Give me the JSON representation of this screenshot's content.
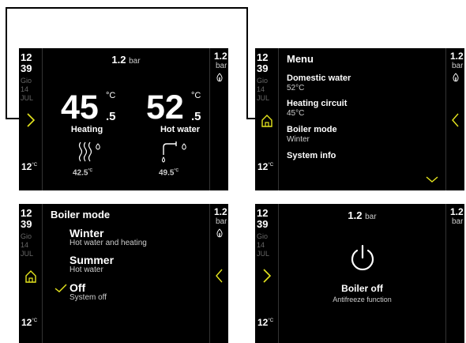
{
  "status_bar": {
    "hour": "12",
    "minute": "39",
    "weekday": "Gio",
    "day": "14",
    "month": "JUL",
    "outdoor_temp": "12",
    "outdoor_unit": "°C",
    "pressure_value": "1.2",
    "pressure_unit": "bar"
  },
  "home": {
    "pressure_value": "1.2",
    "pressure_unit": "bar",
    "heating": {
      "integer": "45",
      "decimal": ".5",
      "unit": "°C",
      "label": "Heating",
      "setpoint": "42.5",
      "setpoint_unit": "°C",
      "icon": "radiator-heat-icon"
    },
    "hot_water": {
      "integer": "52",
      "decimal": ".5",
      "unit": "°C",
      "label": "Hot water",
      "setpoint": "49.5",
      "setpoint_unit": "°C",
      "icon": "faucet-icon"
    }
  },
  "menu": {
    "title": "Menu",
    "items": [
      {
        "label": "Domestic water",
        "value": "52°C"
      },
      {
        "label": "Heating circuit",
        "value": "45°C"
      },
      {
        "label": "Boiler mode",
        "value": "Winter"
      },
      {
        "label": "System info",
        "value": ""
      }
    ]
  },
  "boiler_mode": {
    "title": "Boiler mode",
    "options": [
      {
        "label": "Winter",
        "description": "Hot water and heating",
        "selected": false
      },
      {
        "label": "Summer",
        "description": "Hot water",
        "selected": false
      },
      {
        "label": "Off",
        "description": "System off",
        "selected": true
      }
    ]
  },
  "boiler_off": {
    "pressure_value": "1.2",
    "pressure_unit": "bar",
    "title": "Boiler off",
    "subtitle": "Antifreeze function"
  },
  "colors": {
    "accent": "#e6e61e",
    "background": "#000000",
    "text": "#ffffff",
    "muted": "#666666"
  }
}
